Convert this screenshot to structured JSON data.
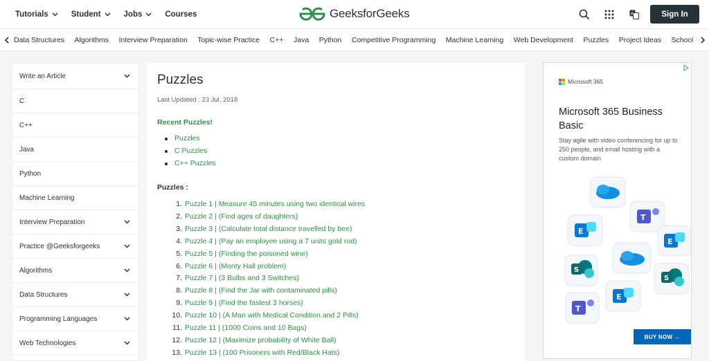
{
  "header": {
    "nav": [
      {
        "label": "Tutorials",
        "has_dropdown": true
      },
      {
        "label": "Student",
        "has_dropdown": true
      },
      {
        "label": "Jobs",
        "has_dropdown": true
      },
      {
        "label": "Courses",
        "has_dropdown": false
      }
    ],
    "logo_text": "GeeksforGeeks",
    "signin_label": "Sign In",
    "icons": [
      "search-icon",
      "apps-grid-icon",
      "translate-icon"
    ]
  },
  "subnav": {
    "items": [
      "Data Structures",
      "Algorithms",
      "Interview Preparation",
      "Topic-wise Practice",
      "C++",
      "Java",
      "Python",
      "Competitive Programming",
      "Machine Learning",
      "Web Development",
      "Puzzles",
      "Project Ideas",
      "School Learning"
    ]
  },
  "sidebar": {
    "items": [
      {
        "label": "Write an Article",
        "expandable": true
      },
      {
        "label": "C",
        "expandable": false
      },
      {
        "label": "C++",
        "expandable": false
      },
      {
        "label": "Java",
        "expandable": false
      },
      {
        "label": "Python",
        "expandable": false
      },
      {
        "label": "Machine Learning",
        "expandable": false
      },
      {
        "label": "Interview Preparation",
        "expandable": true
      },
      {
        "label": "Practice @Geeksforgeeks",
        "expandable": true
      },
      {
        "label": "Algorithms",
        "expandable": true
      },
      {
        "label": "Data Structures",
        "expandable": true
      },
      {
        "label": "Programming Languages",
        "expandable": true
      },
      {
        "label": "Web Technologies",
        "expandable": true
      }
    ]
  },
  "article": {
    "title": "Puzzles",
    "last_updated": "Last Updated : 23 Jul, 2018",
    "recent_heading": "Recent Puzzles!",
    "recent": [
      "Puzzles",
      "C Puzzles",
      "C++ Puzzles"
    ],
    "puzzles_heading": "Puzzles :",
    "puzzles": [
      {
        "num": "1.",
        "text": "Puzzle 1 | Measure 45 minutes using two identical wires"
      },
      {
        "num": "2.",
        "text": "Puzzle 2 | (Find ages of daughters)"
      },
      {
        "num": "3.",
        "text": "Puzzle 3 | (Calculate total distance travelled by bee)"
      },
      {
        "num": "4.",
        "text": "Puzzle 4 | (Pay an employee using a 7 units gold rod)"
      },
      {
        "num": "5.",
        "text": "Puzzle 5 | (Finding the poisoned wine)"
      },
      {
        "num": "6.",
        "text": "Puzzle 6 | (Monty Hall problem)"
      },
      {
        "num": "7.",
        "text": "Puzzle 7 | (3 Bulbs and 3 Switches)"
      },
      {
        "num": "8.",
        "text": "Puzzle 8 | (Find the Jar with contaminated pills)"
      },
      {
        "num": "9.",
        "text": "Puzzle 9 | (Find the fastest 3 horses)"
      },
      {
        "num": "10.",
        "text": "Puzzle 10 | (A Man with Medical Condition and 2 Pills)"
      },
      {
        "num": "11.",
        "text": "Puzzle 11 | (1000 Coins and 10 Bags)"
      },
      {
        "num": "12.",
        "text": "Puzzle 12 | (Maximize probability of White Ball)"
      },
      {
        "num": "13.",
        "text": "Puzzle 13 | (100 Prisoners with Red/Black Hats)"
      }
    ]
  },
  "ad": {
    "brand": "Microsoft 365",
    "title": "Microsoft 365 Business Basic",
    "description": "Stay agile with video conferencing for up to 250 people, and email hosting with a custom domain",
    "cta": "BUY NOW →"
  },
  "colors": {
    "gfg_green": "#2f8d46",
    "dark": "#273239",
    "ms_blue": "#0067b8"
  }
}
